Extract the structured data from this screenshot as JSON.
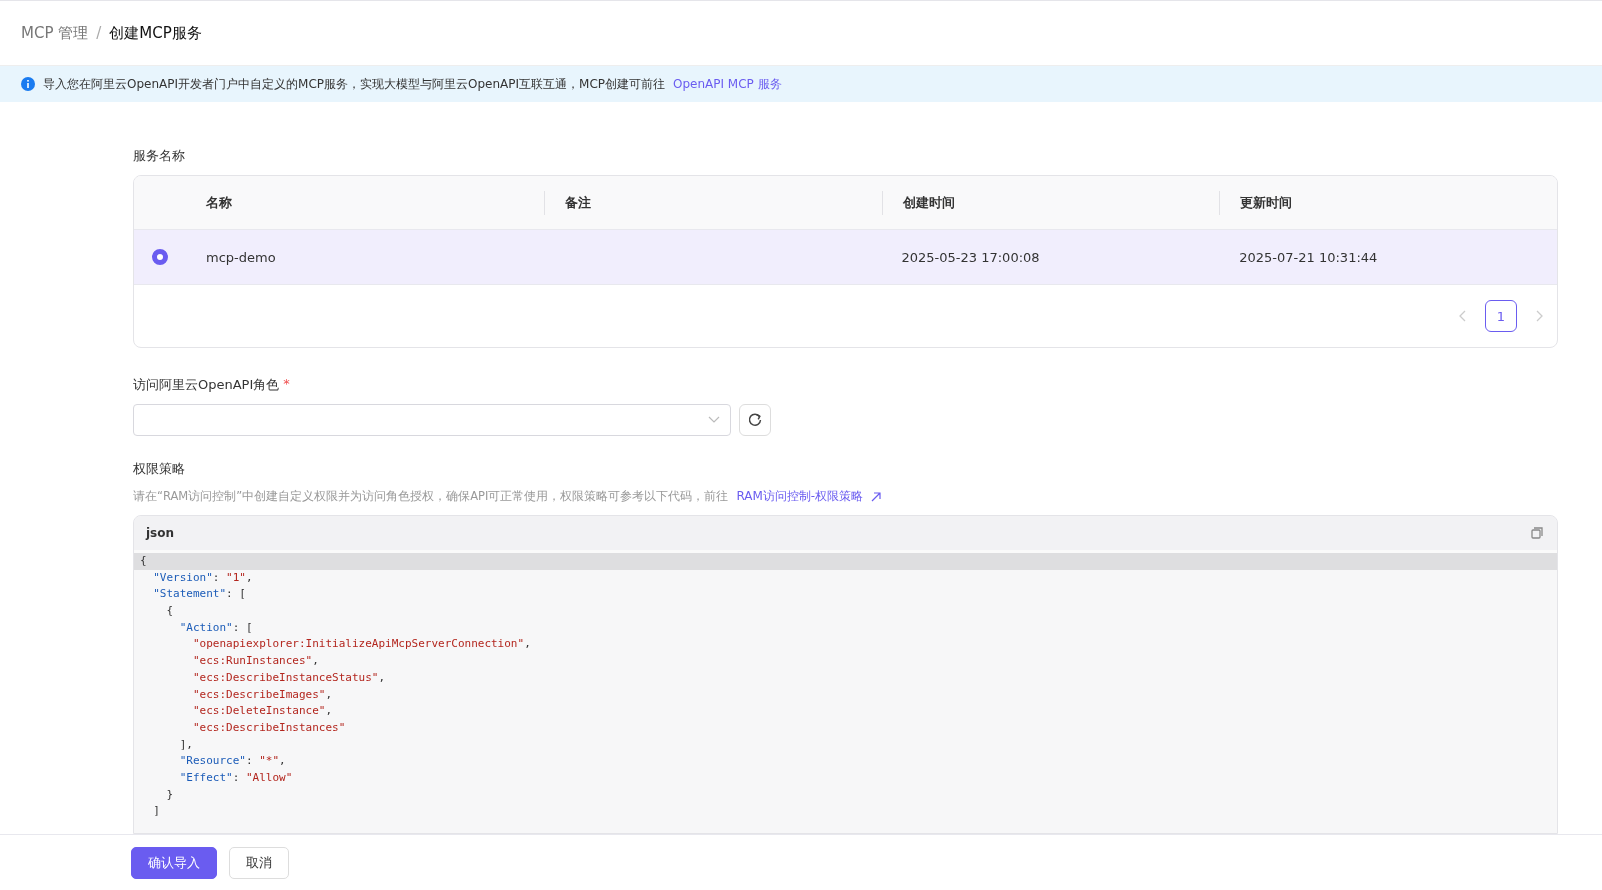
{
  "breadcrumb": [
    {
      "label": "MCP 管理",
      "current": false
    },
    {
      "label": "创建MCP服务",
      "current": true
    }
  ],
  "breadcrumb_separator": "/",
  "notice": {
    "text": "导入您在阿里云OpenAPI开发者门户中自定义的MCP服务，实现大模型与阿里云OpenAPI互联互通，MCP创建可前往",
    "link": "OpenAPI MCP 服务"
  },
  "service_section": {
    "label": "服务名称",
    "table": {
      "columns": [
        "名称",
        "备注",
        "创建时间",
        "更新时间"
      ],
      "rows": [
        {
          "selected": true,
          "cells": [
            "mcp-demo",
            "",
            "2025-05-23 17:00:08",
            "2025-07-21 10:31:44"
          ]
        }
      ]
    },
    "pagination": {
      "pages": [
        {
          "label": "1",
          "selected": true
        }
      ]
    }
  },
  "role_section": {
    "label": "访问阿里云OpenAPI角色",
    "required": true,
    "required_mark": "*"
  },
  "policy_section": {
    "label": "权限策略",
    "hint": "请在“RAM访问控制”中创建自定义权限并为访问角色授权，确保API可正常使用，权限策略可参考以下代码，前往",
    "link": "RAM访问控制-权限策略",
    "code": {
      "language": "json",
      "lines": [
        {
          "text": "{",
          "highlighted": true
        },
        {
          "text": "  \"Version\": \"1\",",
          "highlighted": false
        },
        {
          "text": "  \"Statement\": [",
          "highlighted": false
        },
        {
          "text": "    {",
          "highlighted": false
        },
        {
          "text": "      \"Action\": [",
          "highlighted": false
        },
        {
          "text": "        \"openapiexplorer:InitializeApiMcpServerConnection\",",
          "highlighted": false
        },
        {
          "text": "        \"ecs:RunInstances\",",
          "highlighted": false
        },
        {
          "text": "        \"ecs:DescribeInstanceStatus\",",
          "highlighted": false
        },
        {
          "text": "        \"ecs:DescribeImages\",",
          "highlighted": false
        },
        {
          "text": "        \"ecs:DeleteInstance\",",
          "highlighted": false
        },
        {
          "text": "        \"ecs:DescribeInstances\"",
          "highlighted": false
        },
        {
          "text": "      ],",
          "highlighted": false
        },
        {
          "text": "      \"Resource\": \"*\",",
          "highlighted": false
        },
        {
          "text": "      \"Effect\": \"Allow\"",
          "highlighted": false
        },
        {
          "text": "    }",
          "highlighted": false
        },
        {
          "text": "  ]",
          "highlighted": false
        }
      ]
    }
  },
  "buttons": [
    {
      "label": "确认导入",
      "kind": "primary"
    },
    {
      "label": "取消",
      "kind": "default"
    }
  ]
}
